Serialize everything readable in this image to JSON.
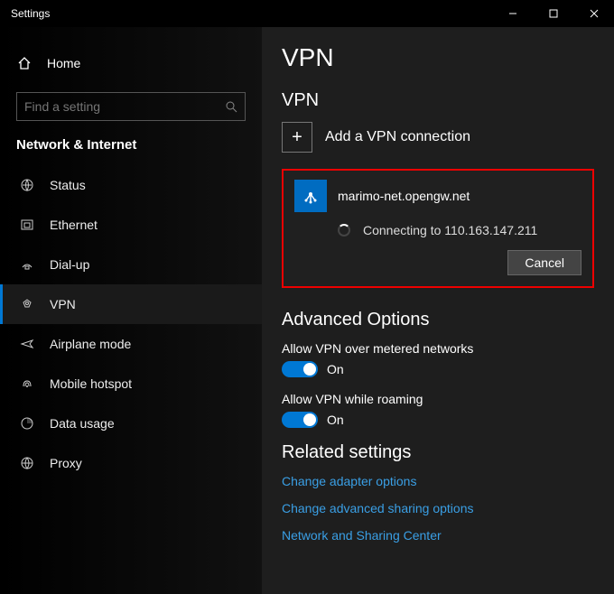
{
  "titlebar": {
    "title": "Settings"
  },
  "sidebar": {
    "home_label": "Home",
    "search_placeholder": "Find a setting",
    "category": "Network & Internet",
    "items": [
      {
        "label": "Status"
      },
      {
        "label": "Ethernet"
      },
      {
        "label": "Dial-up"
      },
      {
        "label": "VPN"
      },
      {
        "label": "Airplane mode"
      },
      {
        "label": "Mobile hotspot"
      },
      {
        "label": "Data usage"
      },
      {
        "label": "Proxy"
      }
    ]
  },
  "main": {
    "heading": "VPN",
    "section": "VPN",
    "add_label": "Add a VPN connection",
    "connection": {
      "name": "marimo-net.opengw.net",
      "status": "Connecting to 110.163.147.211",
      "cancel_label": "Cancel"
    },
    "advanced": {
      "title": "Advanced Options",
      "opt1_label": "Allow VPN over metered networks",
      "opt1_state": "On",
      "opt2_label": "Allow VPN while roaming",
      "opt2_state": "On"
    },
    "related": {
      "title": "Related settings",
      "links": [
        "Change adapter options",
        "Change advanced sharing options",
        "Network and Sharing Center"
      ]
    }
  }
}
